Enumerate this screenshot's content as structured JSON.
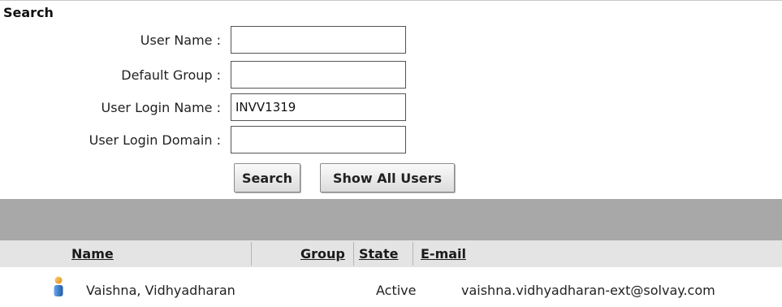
{
  "search": {
    "title": "Search",
    "fields": [
      {
        "label": "User Name :",
        "value": "",
        "placeholder": ""
      },
      {
        "label": "Default Group :",
        "value": "",
        "placeholder": ""
      },
      {
        "label": "User Login Name :",
        "value": "INVV1319",
        "placeholder": ""
      },
      {
        "label": "User Login Domain :",
        "value": "",
        "placeholder": ""
      }
    ],
    "buttons": {
      "search_label": "Search",
      "show_all_label": "Show All Users"
    }
  },
  "results": {
    "columns": {
      "name": "Name",
      "group": "Group",
      "state": "State",
      "email": "E-mail"
    },
    "rows": [
      {
        "icon": "user-icon",
        "name": "Vaishna, Vidhyadharan",
        "group": "",
        "state": "Active",
        "email": "vaishna.vidhyadharan-ext@solvay.com"
      }
    ]
  },
  "colors": {
    "bar_grey": "#a8a8a8",
    "header_bg": "#e4e4e4",
    "icon_blue": "#3a78c8",
    "icon_orange": "#f0a020"
  }
}
